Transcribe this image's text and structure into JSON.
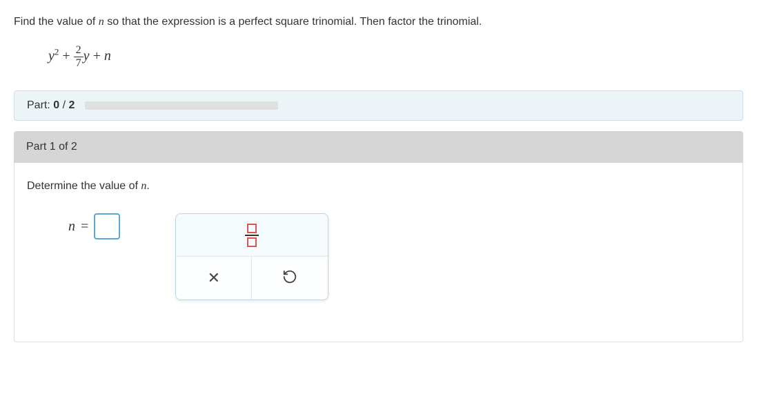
{
  "question": {
    "text_before_n": "Find the value of ",
    "var_n": "n",
    "text_after_n": " so that the expression is a perfect square trinomial. Then factor the trinomial."
  },
  "expression": {
    "base1": "y",
    "exp1": "2",
    "plus1": "+",
    "frac_num": "2",
    "frac_den": "7",
    "base2": "y",
    "plus2": "+",
    "var_n": "n"
  },
  "progress": {
    "label_prefix": "Part: ",
    "current": "0",
    "sep": " / ",
    "total": "2",
    "fill_percent": 0
  },
  "part": {
    "header": "Part 1 of 2",
    "prompt_before": "Determine the value of ",
    "prompt_var": "n",
    "prompt_after": ".",
    "answer_var": "n",
    "equals": "=",
    "answer_value": ""
  },
  "toolbar": {
    "fraction_tool": "fraction",
    "clear": "clear",
    "undo": "undo"
  }
}
